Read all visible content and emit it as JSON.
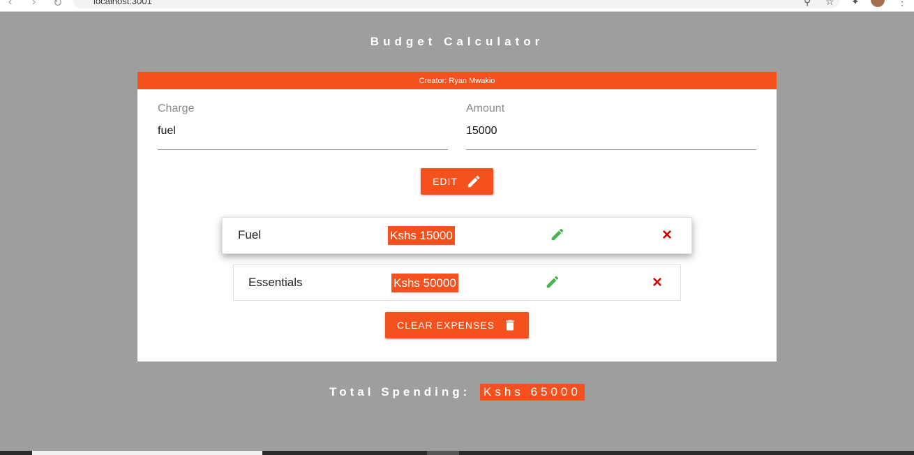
{
  "browser": {
    "url": "localhost:3001"
  },
  "app": {
    "title": "Budget Calculator",
    "creator": "Creator: Ryan Mwakio"
  },
  "form": {
    "charge": {
      "label": "Charge",
      "value": "fuel"
    },
    "amount": {
      "label": "Amount",
      "value": "15000"
    },
    "submit_label": "EDIT"
  },
  "expenses": [
    {
      "name": "Fuel",
      "amount": "Kshs 15000"
    },
    {
      "name": "Essentials",
      "amount": "Kshs 50000"
    }
  ],
  "clear_label": "CLEAR EXPENSES",
  "total": {
    "label": "Total Spending:",
    "amount": "Kshs 65000"
  },
  "colors": {
    "accent": "#f4511e",
    "background": "#9e9e9e",
    "edit_icon": "#4caf50",
    "delete_icon": "#d50000"
  },
  "icons": {
    "edit": "pencil-icon",
    "delete": "close-icon",
    "clear": "trash-icon"
  }
}
